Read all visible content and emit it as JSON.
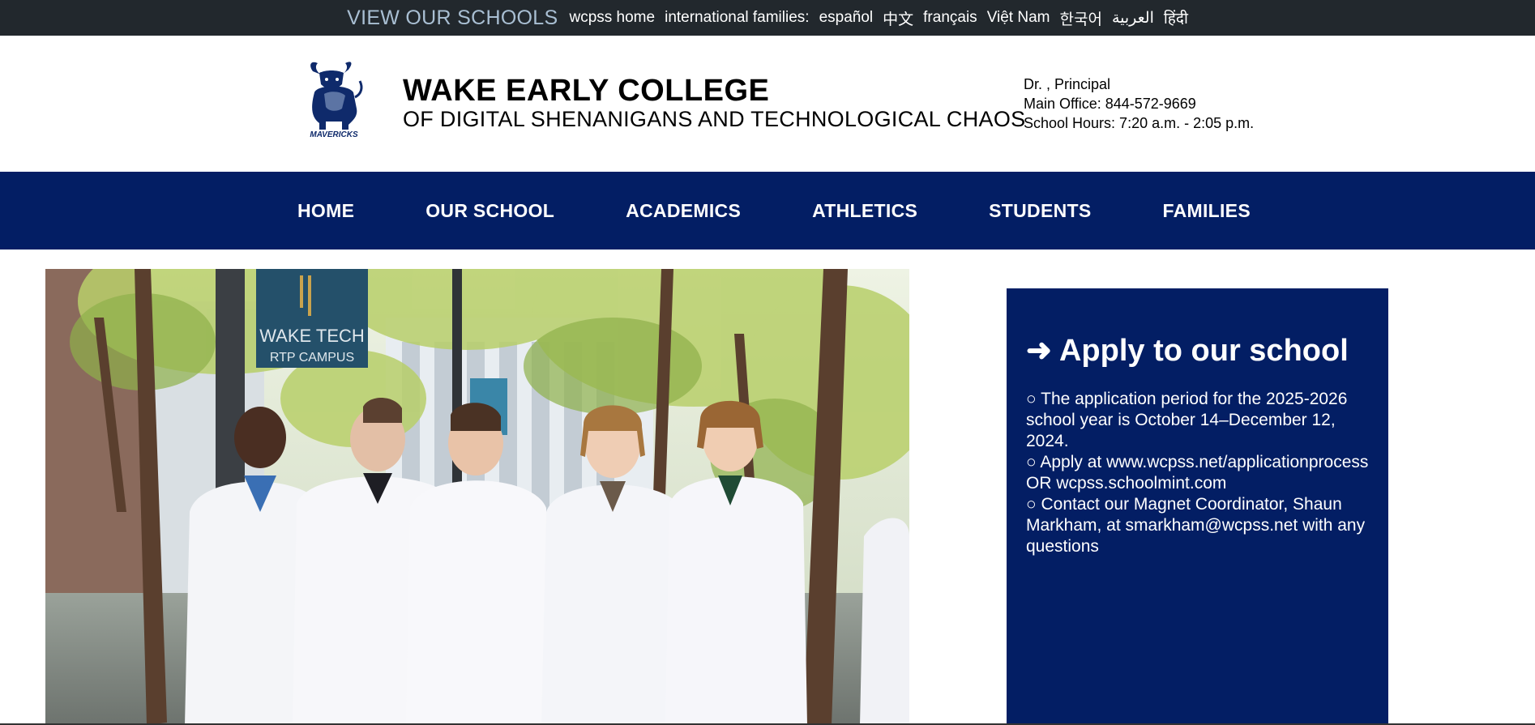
{
  "topbar": {
    "view_schools": "VIEW OUR SCHOOLS",
    "wcpss_home": "wcpss home",
    "international_label": "international families:",
    "languages": [
      "español",
      "中文",
      "français",
      "Việt Nam",
      "한국어",
      "العربية",
      "हिंदी"
    ]
  },
  "header": {
    "logo_text": "MAVERICKS",
    "name_line1": "WAKE EARLY COLLEGE",
    "name_line2": "OF DIGITAL SHENANIGANS AND TECHNOLOGICAL CHAOS",
    "principal": "Dr. , Principal",
    "main_office": "Main Office: 844-572-9669",
    "school_hours": "School Hours: 7:20 a.m. - 2:05 p.m."
  },
  "nav": {
    "items": [
      "HOME",
      "OUR SCHOOL",
      "ACADEMICS",
      "ATHLETICS",
      "STUDENTS",
      "FAMILIES"
    ]
  },
  "hero": {
    "banner_line1": "WAKE TECH",
    "banner_line2": "RTP CAMPUS"
  },
  "apply": {
    "title": "➜ Apply to our school",
    "items": [
      "○ The application period for the 2025-2026 school year is October 14–December 12, 2024.",
      "○ Apply at www.wcpss.net/applicationprocess OR wcpss.schoolmint.com",
      "○ Contact our Magnet Coordinator, Shaun Markham, at smarkham@wcpss.net with any questions"
    ]
  },
  "colors": {
    "navy": "#031e64",
    "topbar": "#22282d",
    "view_schools": "#a9bfd3"
  }
}
